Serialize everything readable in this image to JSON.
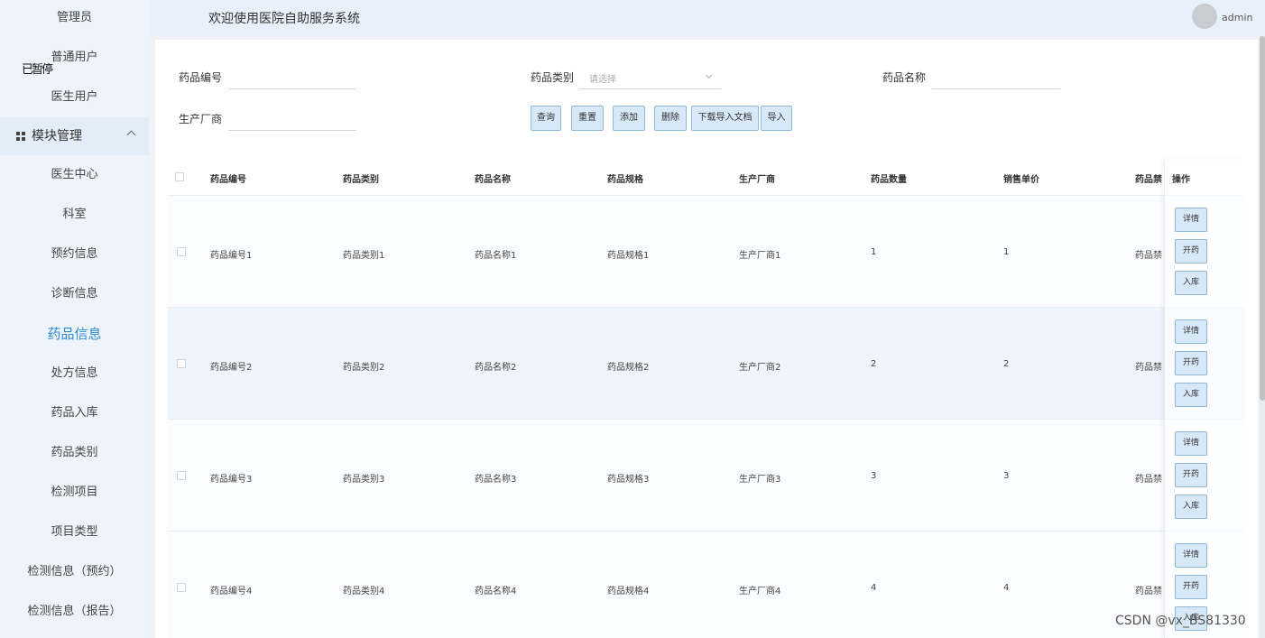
{
  "sidebar": {
    "items_top": [
      "管理员",
      "普通用户",
      "医生用户"
    ],
    "overlay_text": "已暂停",
    "group": {
      "label": "模块管理",
      "icon": "grid-icon",
      "expanded": true
    },
    "items": [
      "医生中心",
      "科室",
      "预约信息",
      "诊断信息",
      "药品信息",
      "处方信息",
      "药品入库",
      "药品类别",
      "检测项目",
      "项目类型",
      "检测信息（预约）",
      "检测信息（报告）"
    ],
    "active": "药品信息"
  },
  "topbar": {
    "welcome": "欢迎使用医院自助服务系统",
    "username": "admin"
  },
  "search": {
    "code_label": "药品编号",
    "category_label": "药品类别",
    "category_placeholder": "请选择",
    "name_label": "药品名称",
    "maker_label": "生产厂商"
  },
  "buttons": [
    "查询",
    "重置",
    "添加",
    "删除",
    "下载导入文档",
    "导入"
  ],
  "table": {
    "headers": [
      "药品编号",
      "药品类别",
      "药品名称",
      "药品规格",
      "生产厂商",
      "药品数量",
      "销售单价",
      "药品禁"
    ],
    "op_header": "操作",
    "op_buttons": [
      "详情",
      "开药",
      "入库"
    ],
    "rows": [
      [
        "药品编号1",
        "药品类别1",
        "药品名称1",
        "药品规格1",
        "生产厂商1",
        "1",
        "1",
        "药品禁"
      ],
      [
        "药品编号2",
        "药品类别2",
        "药品名称2",
        "药品规格2",
        "生产厂商2",
        "2",
        "2",
        "药品禁"
      ],
      [
        "药品编号3",
        "药品类别3",
        "药品名称3",
        "药品规格3",
        "生产厂商3",
        "3",
        "3",
        "药品禁"
      ],
      [
        "药品编号4",
        "药品类别4",
        "药品名称4",
        "药品规格4",
        "生产厂商4",
        "4",
        "4",
        "药品禁"
      ]
    ]
  },
  "watermark": "CSDN @vx_BS81330",
  "colors": {
    "accent": "#2d8ad6",
    "button_bg": "#d7e8f8",
    "button_border": "#8fb7dc",
    "sidebar_bg": "#eef4fb"
  }
}
